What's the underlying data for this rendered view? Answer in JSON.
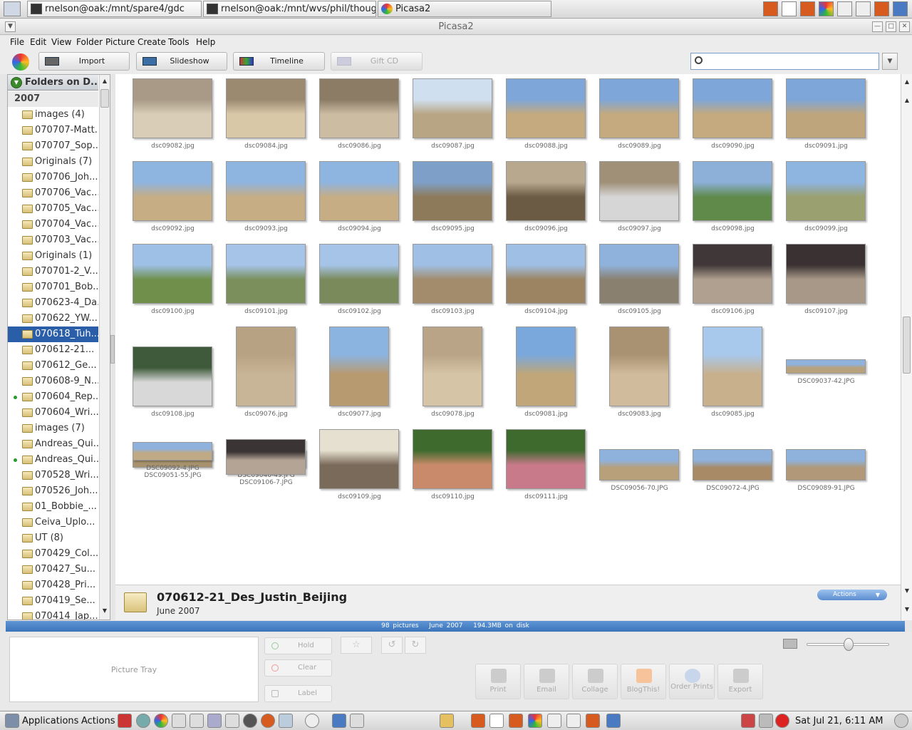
{
  "taskbar": {
    "tasks": [
      {
        "label": "rnelson@oak:/mnt/spare4/gdc"
      },
      {
        "label": "rnelson@oak:/mnt/wvs/phil/thoughtlet"
      },
      {
        "label": "Picasa2"
      }
    ]
  },
  "window": {
    "title": "Picasa2"
  },
  "menu": [
    "File",
    "Edit",
    "View",
    "Folder",
    "Picture",
    "Create",
    "Tools",
    "Help"
  ],
  "toolbar": {
    "import": "Import",
    "slideshow": "Slideshow",
    "timeline": "Timeline",
    "giftcd": "Gift CD",
    "search_value": ""
  },
  "sidebar": {
    "header": "Folders on D...",
    "year": "2007",
    "items": [
      "images (4)",
      "070707-Matt...",
      "070707_Sop...",
      "Originals (7)",
      "070706_Joh...",
      "070706_Vac...",
      "070705_Vac...",
      "070704_Vac...",
      "070703_Vac...",
      "Originals (1)",
      "070701-2_V...",
      "070701_Bob...",
      "070623-4_Da...",
      "070622_YW...",
      "070618_Tuh...",
      "070612-21...",
      "070612_Ge...",
      "070608-9_N...",
      "070604_Rep...",
      "070604_Wri...",
      "images (7)",
      "Andreas_Qui...",
      "Andreas_Qui...",
      "070528_Wri...",
      "070526_Joh...",
      "01_Bobbie_...",
      "Ceiva_Uplo...",
      "UT (8)",
      "070429_Col...",
      "070427_Su...",
      "070428_Pri...",
      "070419_Se...",
      "070414_Jap..."
    ],
    "selected_index": 14,
    "synced_indices": [
      18,
      22
    ]
  },
  "photos": [
    "dsc09082.jpg",
    "dsc09084.jpg",
    "dsc09086.jpg",
    "dsc09087.jpg",
    "dsc09088.jpg",
    "dsc09089.jpg",
    "dsc09090.jpg",
    "dsc09091.jpg",
    "dsc09092.jpg",
    "dsc09093.jpg",
    "dsc09094.jpg",
    "dsc09095.jpg",
    "dsc09096.jpg",
    "dsc09097.jpg",
    "dsc09098.jpg",
    "dsc09099.jpg",
    "dsc09100.jpg",
    "dsc09101.jpg",
    "dsc09102.jpg",
    "dsc09103.jpg",
    "dsc09104.jpg",
    "dsc09105.jpg",
    "dsc09106.jpg",
    "dsc09107.jpg",
    "dsc09108.jpg",
    "dsc09076.jpg",
    "dsc09077.jpg",
    "dsc09078.jpg",
    "dsc09081.jpg",
    "dsc09083.jpg",
    "dsc09085.jpg",
    "DSC09037-42.JPG",
    "DSC09051-55.JPG",
    "DSC09046-49.JPG",
    "dsc09109.jpg",
    "dsc09110.jpg",
    "dsc09111.jpg",
    "DSC09056-70.JPG",
    "DSC09072-4.JPG",
    "DSC09089-91.JPG",
    "DSC09092-4.JPG",
    "DSC09106-7.JPG"
  ],
  "folder_info": {
    "name": "070612-21_Des_Justin_Beijing",
    "date": "June 2007",
    "actions": "Actions"
  },
  "status": {
    "pictures": "98 pictures",
    "date": "June 2007",
    "size": "194.3MB on disk"
  },
  "bottom": {
    "tray": "Picture Tray",
    "hold": "Hold",
    "clear": "Clear",
    "label": "Label",
    "buttons": [
      "Print",
      "Email",
      "Collage",
      "BlogThis!",
      "Order Prints",
      "Export"
    ]
  },
  "gnome": {
    "applications": "Applications",
    "actions": "Actions",
    "clock": "Sat Jul 21,  6:11 AM"
  }
}
